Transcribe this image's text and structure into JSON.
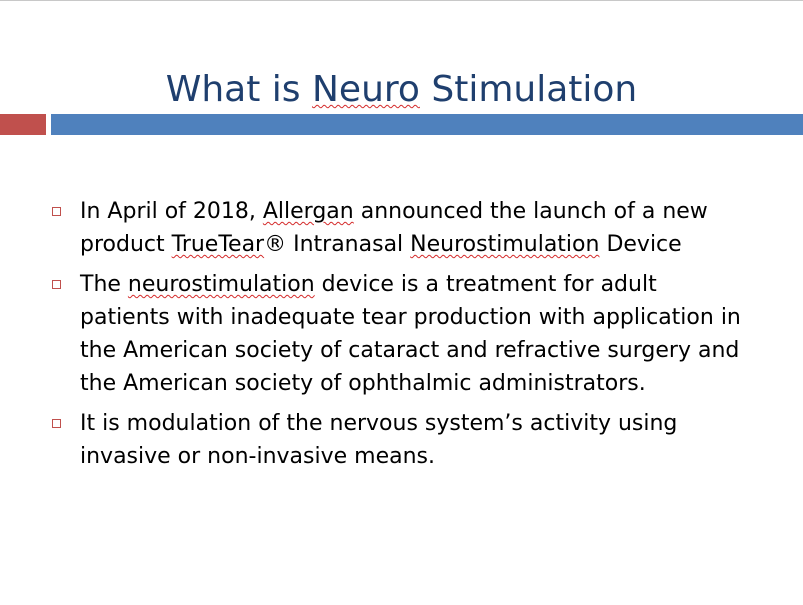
{
  "slide": {
    "title": {
      "part1": "What is ",
      "part2": "Neuro",
      "part3": " Stimulation"
    },
    "bullets": [
      {
        "t1": "In April of 2018,  ",
        "t2": "Allergan",
        "t3": " announced the launch of a new product ",
        "t4": "TrueTear",
        "t5": "® Intranasal ",
        "t6": "Neurostimulation",
        "t7": " Device"
      },
      {
        "t1": "The ",
        "t2": "neurostimulation",
        "t3": " device is a treatment for adult patients with inadequate tear production with application in the American society of cataract and refractive surgery and the American society of ophthalmic administrators."
      },
      {
        "t1": "It is  modulation of the nervous system’s activity using invasive or non-invasive means."
      }
    ]
  },
  "colors": {
    "title": "#1f3f6e",
    "accent_red": "#c0504d",
    "accent_blue": "#4f81bd",
    "bullet_marker": "#c0504d",
    "spellcheck_underline": "#d42a2a"
  },
  "icons": {
    "bullet": "hollow-square-icon"
  }
}
